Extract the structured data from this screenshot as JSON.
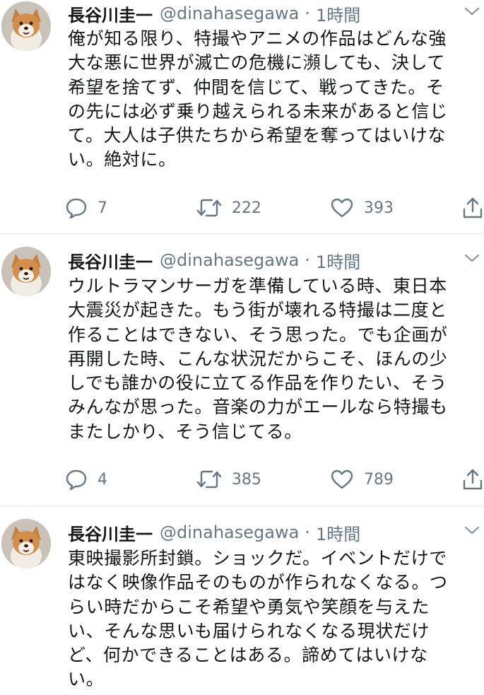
{
  "tweets": [
    {
      "name": "長谷川圭一",
      "handle": "@dinahasegawa",
      "separator": "·",
      "time": "1時間",
      "text": "俺が知る限り、特撮やアニメの作品はどんな強\n大な悪に世界が滅亡の危機に瀕しても、決して\n希望を捨てず、仲間を信じて、戦ってきた。そ\nの先には必ず乗り越えられる未来があると信じ\nて。大人は子供たちから希望を奪ってはいけな\nい。絶対に。",
      "replies": "7",
      "retweets": "222",
      "likes": "393"
    },
    {
      "name": "長谷川圭一",
      "handle": "@dinahasegawa",
      "separator": "·",
      "time": "1時間",
      "text": "ウルトラマンサーガを準備している時、東日本\n大震災が起きた。もう街が壊れる特撮は二度と\n作ることはできない、そう思った。でも企画が\n再開した時、こんな状況だからこそ、ほんの少\nしでも誰かの役に立てる作品を作りたい、そう\nみんなが思った。音楽の力がエールなら特撮も\nまたしかり、そう信じてる。",
      "replies": "4",
      "retweets": "385",
      "likes": "789"
    },
    {
      "name": "長谷川圭一",
      "handle": "@dinahasegawa",
      "separator": "·",
      "time": "1時間",
      "text": "東映撮影所封鎖。ショックだ。イベントだけで\nはなく映像作品そのものが作られなくなる。つ\nらい時だからこそ希望や勇気や笑顔を与えた\nい、そんな思いも届けられなくなる現状だけ\nど、何かできることはある。諦めてはいけな\nい。"
    }
  ],
  "icons": {
    "reply": "reply-icon",
    "retweet": "retweet-icon",
    "like": "heart-icon",
    "share": "share-icon",
    "menu": "chevron-down-icon"
  },
  "colors": {
    "text": "#14171a",
    "secondary": "#657786",
    "divider": "#e6ecf0"
  }
}
